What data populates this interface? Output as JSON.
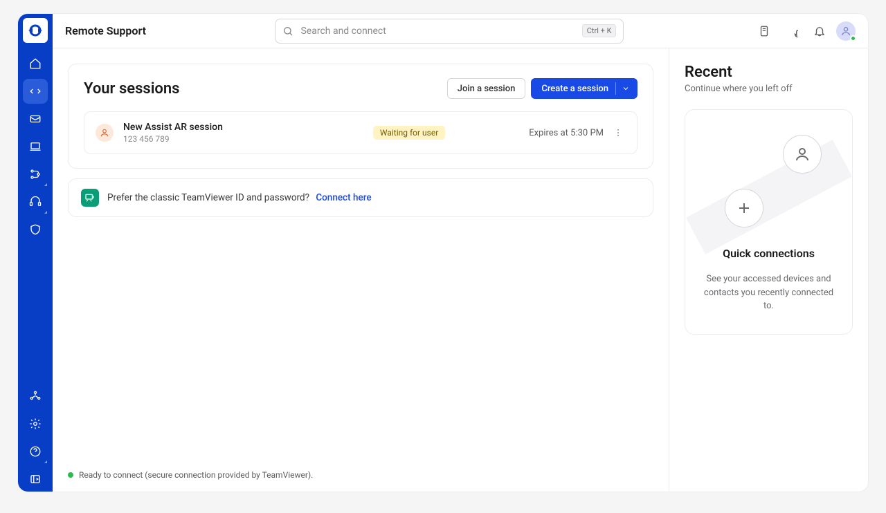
{
  "header": {
    "title": "Remote Support",
    "search_placeholder": "Search and connect",
    "search_kbd": "Ctrl + K"
  },
  "sessions": {
    "title": "Your sessions",
    "join_label": "Join a session",
    "create_label": "Create a session",
    "items": [
      {
        "name": "New Assist AR session",
        "id": "123 456 789",
        "status": "Waiting for user",
        "expires": "Expires at 5:30 PM"
      }
    ]
  },
  "classic": {
    "text": "Prefer the classic TeamViewer ID and password?",
    "link": "Connect here"
  },
  "recent": {
    "title": "Recent",
    "subtitle": "Continue where you left off",
    "quick_title": "Quick connections",
    "quick_desc": "See your accessed devices and contacts you recently connected to."
  },
  "footer": {
    "status": "Ready to connect (secure connection provided by TeamViewer)."
  }
}
